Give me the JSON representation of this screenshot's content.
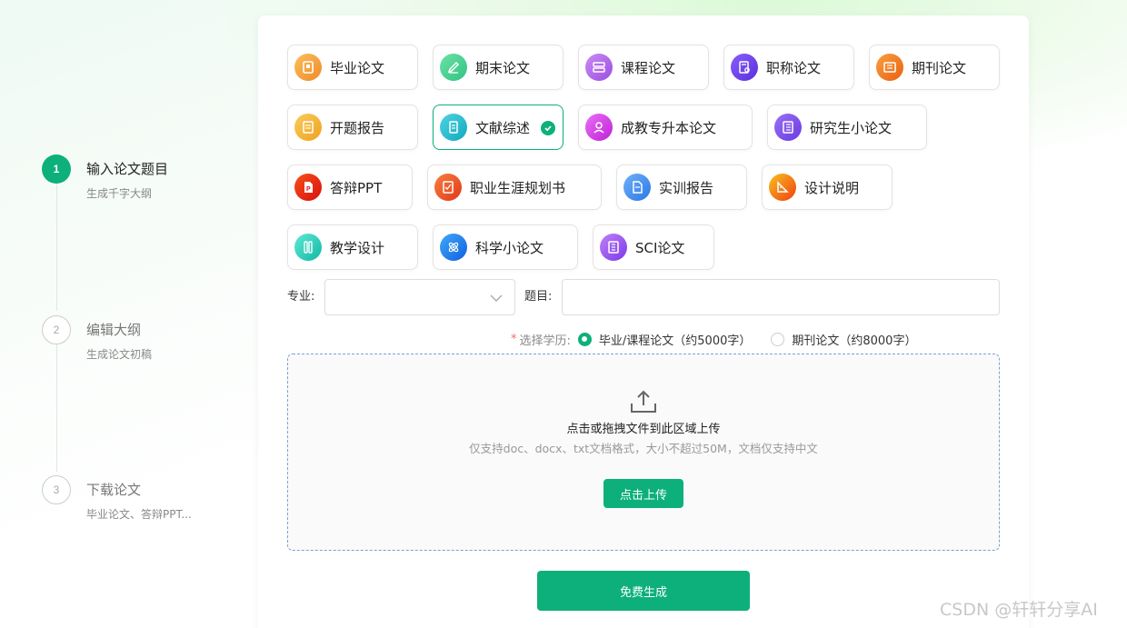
{
  "steps": [
    {
      "num": "1",
      "title": "输入论文题目",
      "sub": "生成千字大纲"
    },
    {
      "num": "2",
      "title": "编辑大纲",
      "sub": "生成论文初稿"
    },
    {
      "num": "3",
      "title": "下载论文",
      "sub": "毕业论文、答辩PPT..."
    }
  ],
  "types": [
    {
      "label": "毕业论文",
      "icon": "book-icon",
      "color": "#f59f3a"
    },
    {
      "label": "期末论文",
      "icon": "pen-icon",
      "color": "#3ecf8e"
    },
    {
      "label": "课程论文",
      "icon": "layers-icon",
      "color": "#b066e8"
    },
    {
      "label": "职称论文",
      "icon": "certificate-icon",
      "color": "#6a3ef0"
    },
    {
      "label": "期刊论文",
      "icon": "newspaper-icon",
      "color": "#f07a1a"
    },
    {
      "label": "开题报告",
      "icon": "report-icon",
      "color": "#f2b53a"
    },
    {
      "label": "文献综述",
      "icon": "document-icon",
      "color": "#1fb8c9"
    },
    {
      "label": "成教专升本论文",
      "icon": "graduate-icon",
      "color": "#d63ee8"
    },
    {
      "label": "研究生小论文",
      "icon": "notebook-icon",
      "color": "#7a4ee8"
    },
    {
      "label": "答辩PPT",
      "icon": "ppt-icon",
      "color": "#e8301c"
    },
    {
      "label": "职业生涯规划书",
      "icon": "career-icon",
      "color": "#f05a2a"
    },
    {
      "label": "实训报告",
      "icon": "training-icon",
      "color": "#3a8cf0"
    },
    {
      "label": "设计说明",
      "icon": "ruler-icon",
      "color": "#f06a1a"
    },
    {
      "label": "教学设计",
      "icon": "teaching-icon",
      "color": "#1ec9b5"
    },
    {
      "label": "科学小论文",
      "icon": "atom-icon",
      "color": "#1a7ef0"
    },
    {
      "label": "SCI论文",
      "icon": "paper-icon",
      "color": "#9a5ae8"
    }
  ],
  "selected_type": "文献综述",
  "form": {
    "major_label": "专业:",
    "major_value": "",
    "title_label": "题目:",
    "title_value": "",
    "required_mark": "*",
    "edu_label": "选择学历:",
    "edu_options": [
      "毕业/课程论文（约5000字）",
      "期刊论文（约8000字）"
    ],
    "edu_selected": 0
  },
  "upload": {
    "icon": "upload-icon",
    "main": "点击或拖拽文件到此区域上传",
    "hint": "仅支持doc、docx、txt文档格式，大小不超过50M，文档仅支持中文",
    "button": "点击上传"
  },
  "generate_button": "免费生成",
  "watermark": "CSDN @轩轩分享AI",
  "colors": {
    "accent": "#0db07a",
    "upload_border": "#7d9fd4"
  }
}
